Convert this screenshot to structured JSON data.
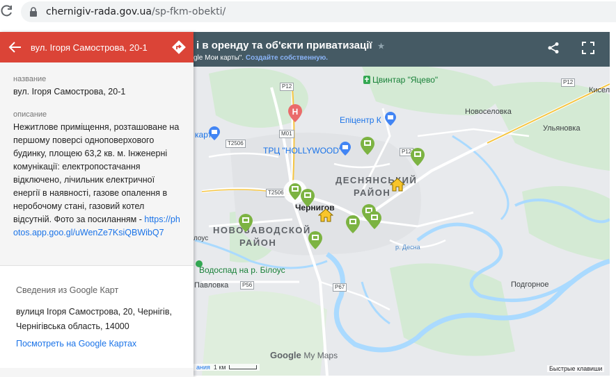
{
  "browser": {
    "url_host": "chernigiv-rada.gov.ua",
    "url_path": "/sp-fkm-obekti/"
  },
  "map": {
    "title": "і в оренду та об'єкти приватизації",
    "subtitle_pre": "gle Мои карты\".",
    "subtitle_link": "Создайте собственную.",
    "labels": {
      "yatsevo": "Цвинтар \"Яцево\"",
      "epicentr": "Епіцентр К",
      "hollywood": "ТРЦ \"HOLLYWOOD\"",
      "novoselovka": "Новоселовка",
      "ulyanovka": "Ульяновка",
      "kiselovka": "Кисел",
      "desnyansky": "ДЕСНЯНСЬКИЙ",
      "rayon1": "РАЙОН",
      "novozavodskoy": "НОВОЗАВОДСКОЙ",
      "rayon2": "РАЙОН",
      "chernigov": "Чернигов",
      "vodospad": "Водоспад на р. Білоус",
      "pavlovka": "Павловка",
      "podgornoe": "Подгорное",
      "desna": "р. Десна",
      "kart": "карт",
      "lous": "лоус"
    },
    "roads": [
      "P12",
      "P12",
      "M01",
      "T2506",
      "T2506",
      "P12",
      "P56",
      "P67"
    ],
    "footer_brand": "Google",
    "footer_mymaps": "My Maps",
    "scale_prefix": "ания",
    "scale": "1 км",
    "shortcuts": "Быстрые клавиши"
  },
  "panel": {
    "title": "вул. Ігоря Самострова, 20-1",
    "name_label": "название",
    "name_value": "вул. Ігоря Самострова, 20-1",
    "desc_label": "описание",
    "desc_text": "Нежитлове приміщення, розташоване на першому поверсі одноповерхового будинку, площею 63,2 кв. м. Інженерні комунікації: електропостачання відключено, лічильник електричної енергії в наявності, газове опалення в неробочому стані, газовий котел відсутній. Фото за посиланням - ",
    "desc_link": "https://photos.app.goo.gl/uWenZe7KsiQBWibQ7",
    "gmaps_title": "Сведения из Google Карт",
    "gmaps_addr": "вулиця Ігоря Самострова, 20, Чернігів, Чернігівська область, 14000",
    "gmaps_link": "Посмотреть на Google Картах"
  },
  "colors": {
    "header_red": "#db4437",
    "map_header": "#455a64",
    "marker_green": "#7cb342",
    "house_yellow": "#f9a825",
    "water": "#aadaff",
    "park": "#c8e6c9"
  }
}
